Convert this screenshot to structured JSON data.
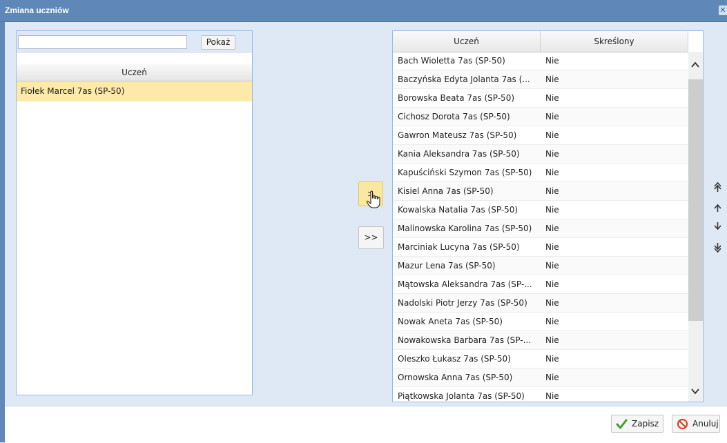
{
  "window": {
    "title": "Zmiana uczniów",
    "close_icon": "close-icon"
  },
  "left": {
    "search": {
      "value": "",
      "placeholder": ""
    },
    "show_label": "Pokaż",
    "column_header": "Uczeń",
    "rows": [
      "Fiołek Marcel 7as (SP-50)"
    ]
  },
  "move": {
    "one_label": ">",
    "all_label": ">>"
  },
  "right": {
    "headers": {
      "student": "Uczeń",
      "removed": "Skreślony"
    },
    "rows": [
      {
        "name": "Bach Wioletta 7as (SP-50)",
        "removed": "Nie"
      },
      {
        "name": "Baczyńska Edyta Jolanta 7as (...",
        "removed": "Nie"
      },
      {
        "name": "Borowska Beata 7as (SP-50)",
        "removed": "Nie"
      },
      {
        "name": "Cichosz Dorota 7as (SP-50)",
        "removed": "Nie"
      },
      {
        "name": "Gawron Mateusz 7as (SP-50)",
        "removed": "Nie"
      },
      {
        "name": "Kania Aleksandra 7as (SP-50)",
        "removed": "Nie"
      },
      {
        "name": "Kapuściński Szymon 7as (SP-50)",
        "removed": "Nie"
      },
      {
        "name": "Kisiel Anna 7as (SP-50)",
        "removed": "Nie"
      },
      {
        "name": "Kowalska Natalia 7as (SP-50)",
        "removed": "Nie"
      },
      {
        "name": "Malinowska Karolina 7as (SP-50)",
        "removed": "Nie"
      },
      {
        "name": "Marciniak Lucyna 7as (SP-50)",
        "removed": "Nie"
      },
      {
        "name": "Mazur Lena 7as (SP-50)",
        "removed": "Nie"
      },
      {
        "name": "Mątowska Aleksandra 7as (SP-...",
        "removed": "Nie"
      },
      {
        "name": "Nadolski Piotr Jerzy 7as (SP-50)",
        "removed": "Nie"
      },
      {
        "name": "Nowak Aneta 7as (SP-50)",
        "removed": "Nie"
      },
      {
        "name": "Nowakowska Barbara 7as (SP-...",
        "removed": "Nie"
      },
      {
        "name": "Oleszko Łukasz 7as (SP-50)",
        "removed": "Nie"
      },
      {
        "name": "Ornowska Anna 7as (SP-50)",
        "removed": "Nie"
      },
      {
        "name": "Piątkowska Jolanta 7as (SP-50)",
        "removed": "Nie"
      }
    ]
  },
  "footer": {
    "save_label": "Zapisz",
    "cancel_label": "Anuluj"
  },
  "colors": {
    "title_bar": "#5f88b8",
    "selected_row": "#fde9a8",
    "save_icon": "#3fa02d",
    "cancel_icon": "#d9401f"
  }
}
